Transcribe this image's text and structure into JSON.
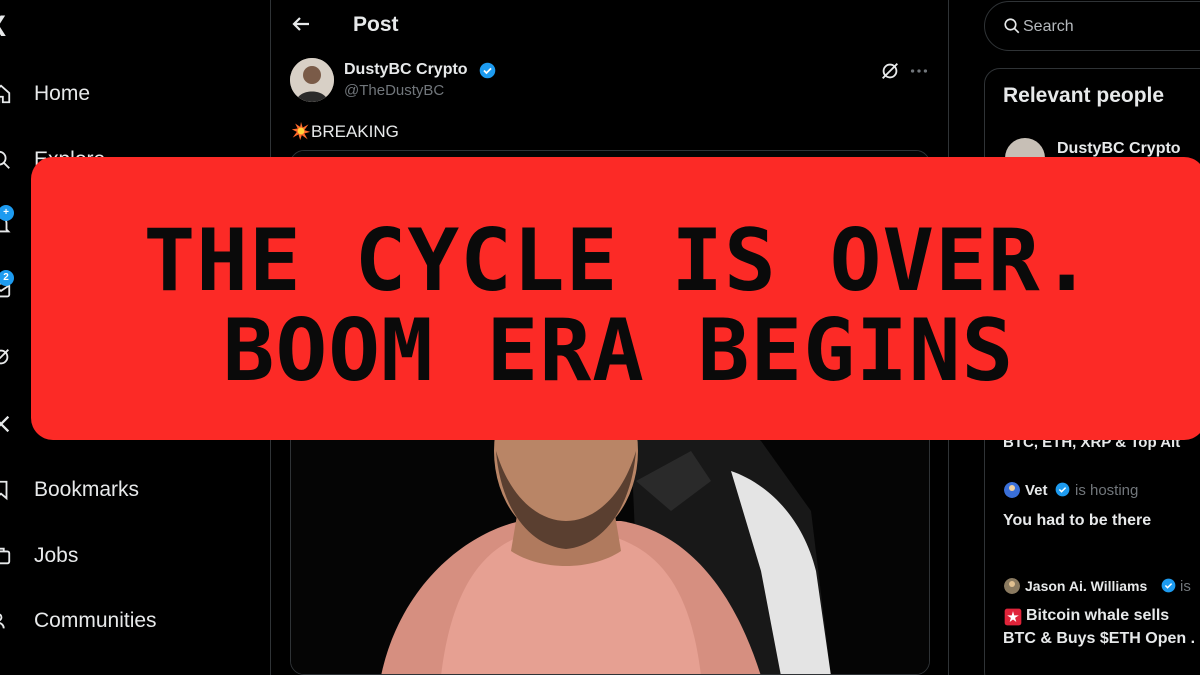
{
  "nav": {
    "logo": "X",
    "items": [
      {
        "label": "Home",
        "icon": "home-icon"
      },
      {
        "label": "Explore",
        "icon": "search-icon"
      },
      {
        "label": "",
        "icon": "bell-icon",
        "badge": "+"
      },
      {
        "label": "",
        "icon": "mail-icon",
        "badge": "2"
      },
      {
        "label": "",
        "icon": "grok-icon"
      },
      {
        "label": "",
        "icon": "x-icon"
      },
      {
        "label": "Bookmarks",
        "icon": "bookmark-icon"
      },
      {
        "label": "Jobs",
        "icon": "briefcase-icon"
      },
      {
        "label": "Communities",
        "icon": "people-icon"
      }
    ]
  },
  "post": {
    "header_title": "Post",
    "author_name": "DustyBC Crypto",
    "author_handle": "@TheDustyBC",
    "text": "BREAKING"
  },
  "right": {
    "search_placeholder": "Search",
    "relevant_title": "Relevant people",
    "relevant_person_name": "DustyBC Crypto",
    "space_line": "BTC, ETH, XRP & Top Alt",
    "host1_name": "Vet",
    "host1_status": "is hosting",
    "host1_title": "You had to be there",
    "host2_name": "Jason Ai. Williams",
    "host2_status": "is",
    "host2_title_line1": "Bitcoin whale sells",
    "host2_title_line2": "BTC & Buys $ETH Open ."
  },
  "banner": {
    "line1": "THE CYCLE IS OVER.",
    "line2": "BOOM ERA BEGINS"
  },
  "colors": {
    "banner_bg": "#fc2a26",
    "accent": "#1d9bf0",
    "background": "#000000"
  }
}
